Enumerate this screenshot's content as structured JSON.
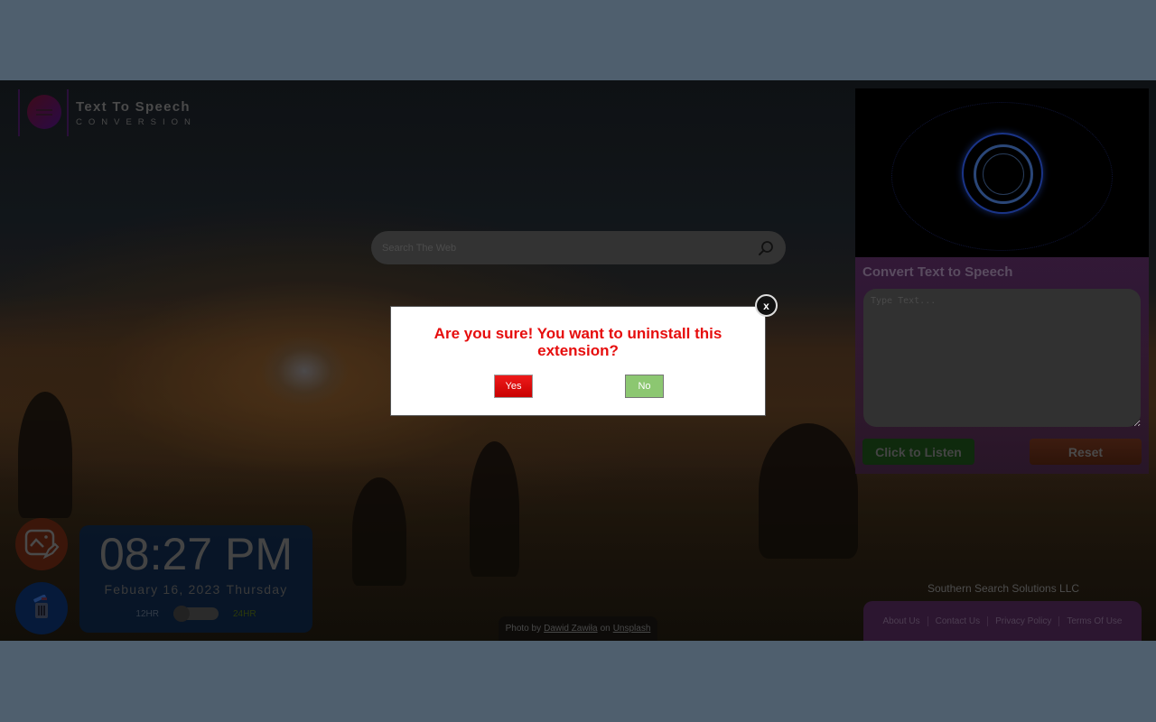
{
  "logo": {
    "title": "Text To Speech",
    "subtitle": "CONVERSION",
    "icon": "speech-bubble-icon"
  },
  "search": {
    "placeholder": "Search The Web",
    "value": "",
    "icon": "search-icon"
  },
  "tts": {
    "title": "Convert Text to Speech",
    "placeholder": "Type Text...",
    "value": "",
    "listen_label": "Click to Listen",
    "reset_label": "Reset"
  },
  "company": "Southern Search Solutions LLC",
  "footer_links": [
    {
      "label": "About Us"
    },
    {
      "label": "Contact Us"
    },
    {
      "label": "Privacy Policy"
    },
    {
      "label": "Terms Of Use"
    }
  ],
  "clock": {
    "time": "08:27 PM",
    "date": "Febuary 16, 2023",
    "weekday": "Thursday",
    "format_12": "12HR",
    "format_24": "24HR",
    "is_24hr": false
  },
  "side_buttons": {
    "background": "image-edit-icon",
    "delete": "trash-icon"
  },
  "credit": {
    "prefix": "Photo by",
    "author": "Dawid Zawiła",
    "middle": "on",
    "site": "Unsplash"
  },
  "modal": {
    "message": "Are you sure! You want to uninstall this extension?",
    "yes_label": "Yes",
    "no_label": "No",
    "close_label": "x"
  },
  "colors": {
    "modal_text": "#e60d0d",
    "yes_button": "#e01010",
    "no_button": "#8cc771"
  }
}
